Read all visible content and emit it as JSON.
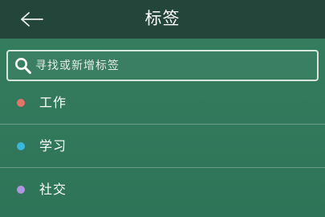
{
  "header": {
    "title": "标签",
    "back_icon": "arrow-left-icon"
  },
  "search": {
    "placeholder": "寻找或新增标签",
    "value": "",
    "icon": "search-icon"
  },
  "tags": [
    {
      "label": "工作",
      "color": "#e57368"
    },
    {
      "label": "学习",
      "color": "#3bb7dc"
    },
    {
      "label": "社交",
      "color": "#b095e0"
    }
  ],
  "colors": {
    "header_bg": "#24453a",
    "body_bg": "#337a5e",
    "text": "#ffffff"
  }
}
